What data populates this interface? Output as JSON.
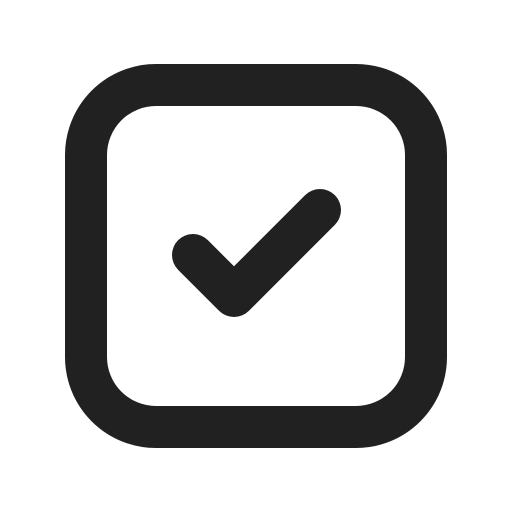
{
  "icon": {
    "name": "checkbox-checked-icon",
    "state": "checked",
    "color": "#212121",
    "background": "#ffffff"
  }
}
